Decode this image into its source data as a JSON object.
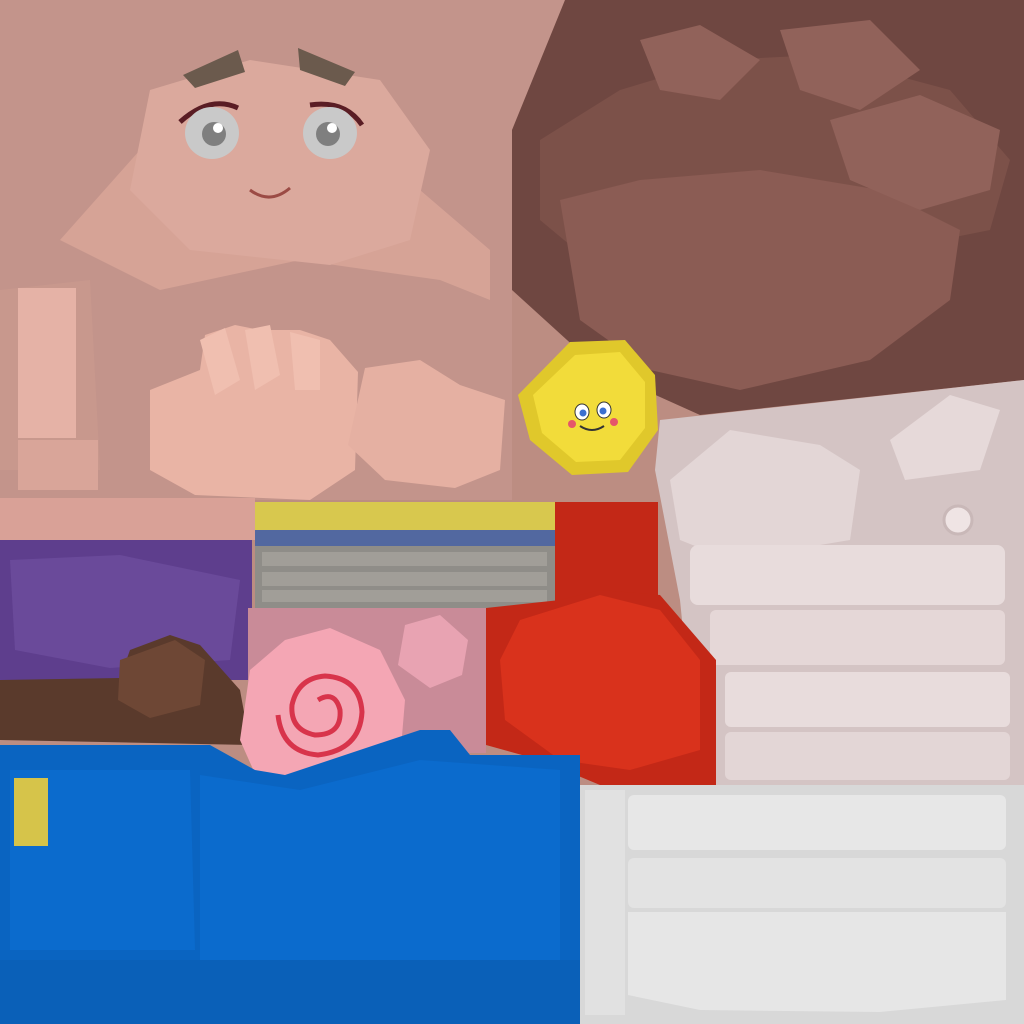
{
  "texture_atlas": {
    "islands": [
      {
        "name": "face-skin",
        "color": "#c99488"
      },
      {
        "name": "hair",
        "color": "#7c5149"
      },
      {
        "name": "coin-smiley",
        "color": "#f2dc3a"
      },
      {
        "name": "white-glove-cuff",
        "color": "#e8dcdc"
      },
      {
        "name": "purple-cloth",
        "color": "#5e3e8d"
      },
      {
        "name": "brown-strap",
        "color": "#5a3a2c"
      },
      {
        "name": "striped-band",
        "color": "#8f8d88"
      },
      {
        "name": "pink-swirl-candy",
        "color": "#f4a6b4"
      },
      {
        "name": "red-cap",
        "color": "#d9321c"
      },
      {
        "name": "blue-shirt",
        "color": "#0a64c1"
      },
      {
        "name": "white-pants",
        "color": "#e7e7e7"
      }
    ],
    "accent_colors": {
      "spiral": "#d8344b",
      "yellow_stripe": "#d8c84e",
      "blue_stripe": "#5268a0",
      "eye_grey": "#c9c9c9",
      "brow": "#6b5a4d"
    }
  }
}
